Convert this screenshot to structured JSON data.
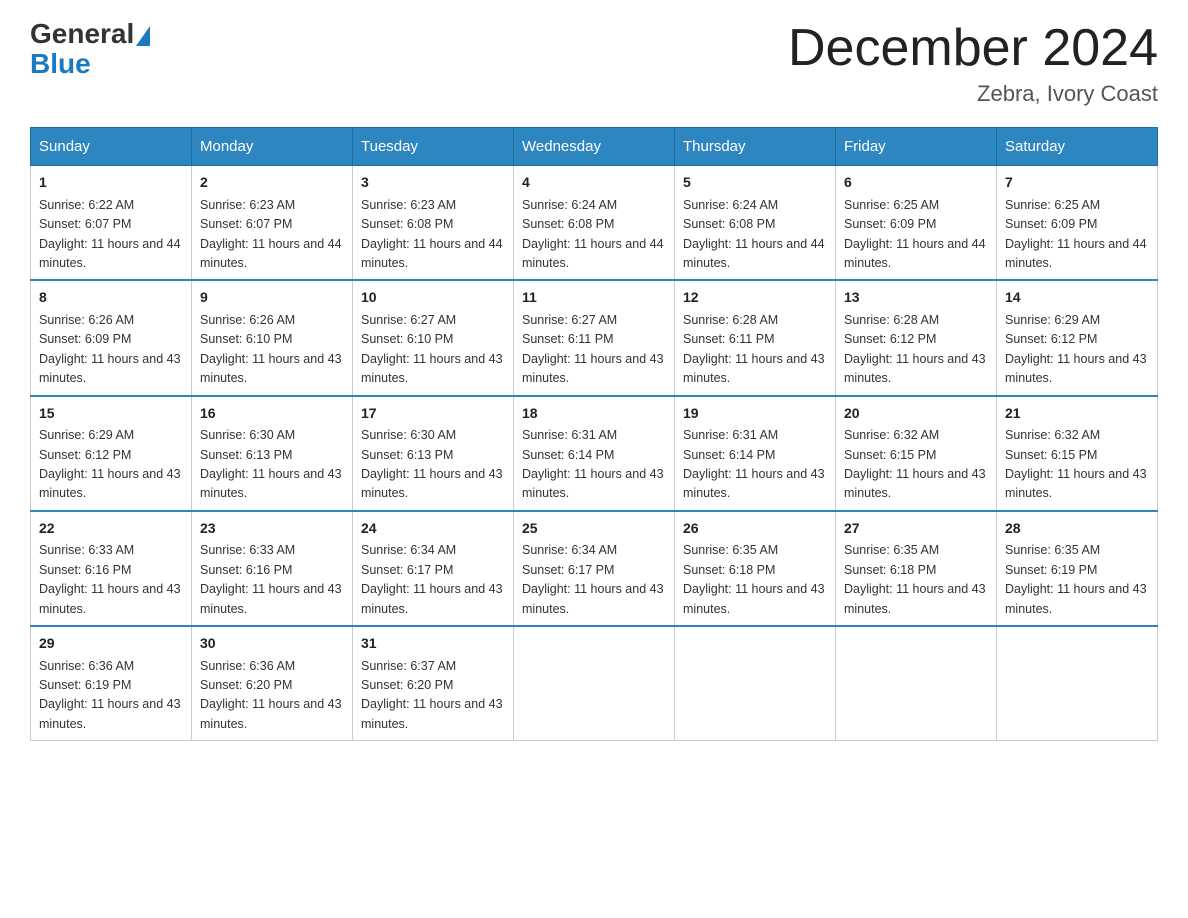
{
  "logo": {
    "general": "General",
    "blue": "Blue"
  },
  "title": {
    "month_year": "December 2024",
    "location": "Zebra, Ivory Coast"
  },
  "days_of_week": [
    "Sunday",
    "Monday",
    "Tuesday",
    "Wednesday",
    "Thursday",
    "Friday",
    "Saturday"
  ],
  "weeks": [
    [
      {
        "day": "1",
        "sunrise": "6:22 AM",
        "sunset": "6:07 PM",
        "daylight": "11 hours and 44 minutes."
      },
      {
        "day": "2",
        "sunrise": "6:23 AM",
        "sunset": "6:07 PM",
        "daylight": "11 hours and 44 minutes."
      },
      {
        "day": "3",
        "sunrise": "6:23 AM",
        "sunset": "6:08 PM",
        "daylight": "11 hours and 44 minutes."
      },
      {
        "day": "4",
        "sunrise": "6:24 AM",
        "sunset": "6:08 PM",
        "daylight": "11 hours and 44 minutes."
      },
      {
        "day": "5",
        "sunrise": "6:24 AM",
        "sunset": "6:08 PM",
        "daylight": "11 hours and 44 minutes."
      },
      {
        "day": "6",
        "sunrise": "6:25 AM",
        "sunset": "6:09 PM",
        "daylight": "11 hours and 44 minutes."
      },
      {
        "day": "7",
        "sunrise": "6:25 AM",
        "sunset": "6:09 PM",
        "daylight": "11 hours and 44 minutes."
      }
    ],
    [
      {
        "day": "8",
        "sunrise": "6:26 AM",
        "sunset": "6:09 PM",
        "daylight": "11 hours and 43 minutes."
      },
      {
        "day": "9",
        "sunrise": "6:26 AM",
        "sunset": "6:10 PM",
        "daylight": "11 hours and 43 minutes."
      },
      {
        "day": "10",
        "sunrise": "6:27 AM",
        "sunset": "6:10 PM",
        "daylight": "11 hours and 43 minutes."
      },
      {
        "day": "11",
        "sunrise": "6:27 AM",
        "sunset": "6:11 PM",
        "daylight": "11 hours and 43 minutes."
      },
      {
        "day": "12",
        "sunrise": "6:28 AM",
        "sunset": "6:11 PM",
        "daylight": "11 hours and 43 minutes."
      },
      {
        "day": "13",
        "sunrise": "6:28 AM",
        "sunset": "6:12 PM",
        "daylight": "11 hours and 43 minutes."
      },
      {
        "day": "14",
        "sunrise": "6:29 AM",
        "sunset": "6:12 PM",
        "daylight": "11 hours and 43 minutes."
      }
    ],
    [
      {
        "day": "15",
        "sunrise": "6:29 AM",
        "sunset": "6:12 PM",
        "daylight": "11 hours and 43 minutes."
      },
      {
        "day": "16",
        "sunrise": "6:30 AM",
        "sunset": "6:13 PM",
        "daylight": "11 hours and 43 minutes."
      },
      {
        "day": "17",
        "sunrise": "6:30 AM",
        "sunset": "6:13 PM",
        "daylight": "11 hours and 43 minutes."
      },
      {
        "day": "18",
        "sunrise": "6:31 AM",
        "sunset": "6:14 PM",
        "daylight": "11 hours and 43 minutes."
      },
      {
        "day": "19",
        "sunrise": "6:31 AM",
        "sunset": "6:14 PM",
        "daylight": "11 hours and 43 minutes."
      },
      {
        "day": "20",
        "sunrise": "6:32 AM",
        "sunset": "6:15 PM",
        "daylight": "11 hours and 43 minutes."
      },
      {
        "day": "21",
        "sunrise": "6:32 AM",
        "sunset": "6:15 PM",
        "daylight": "11 hours and 43 minutes."
      }
    ],
    [
      {
        "day": "22",
        "sunrise": "6:33 AM",
        "sunset": "6:16 PM",
        "daylight": "11 hours and 43 minutes."
      },
      {
        "day": "23",
        "sunrise": "6:33 AM",
        "sunset": "6:16 PM",
        "daylight": "11 hours and 43 minutes."
      },
      {
        "day": "24",
        "sunrise": "6:34 AM",
        "sunset": "6:17 PM",
        "daylight": "11 hours and 43 minutes."
      },
      {
        "day": "25",
        "sunrise": "6:34 AM",
        "sunset": "6:17 PM",
        "daylight": "11 hours and 43 minutes."
      },
      {
        "day": "26",
        "sunrise": "6:35 AM",
        "sunset": "6:18 PM",
        "daylight": "11 hours and 43 minutes."
      },
      {
        "day": "27",
        "sunrise": "6:35 AM",
        "sunset": "6:18 PM",
        "daylight": "11 hours and 43 minutes."
      },
      {
        "day": "28",
        "sunrise": "6:35 AM",
        "sunset": "6:19 PM",
        "daylight": "11 hours and 43 minutes."
      }
    ],
    [
      {
        "day": "29",
        "sunrise": "6:36 AM",
        "sunset": "6:19 PM",
        "daylight": "11 hours and 43 minutes."
      },
      {
        "day": "30",
        "sunrise": "6:36 AM",
        "sunset": "6:20 PM",
        "daylight": "11 hours and 43 minutes."
      },
      {
        "day": "31",
        "sunrise": "6:37 AM",
        "sunset": "6:20 PM",
        "daylight": "11 hours and 43 minutes."
      },
      null,
      null,
      null,
      null
    ]
  ]
}
